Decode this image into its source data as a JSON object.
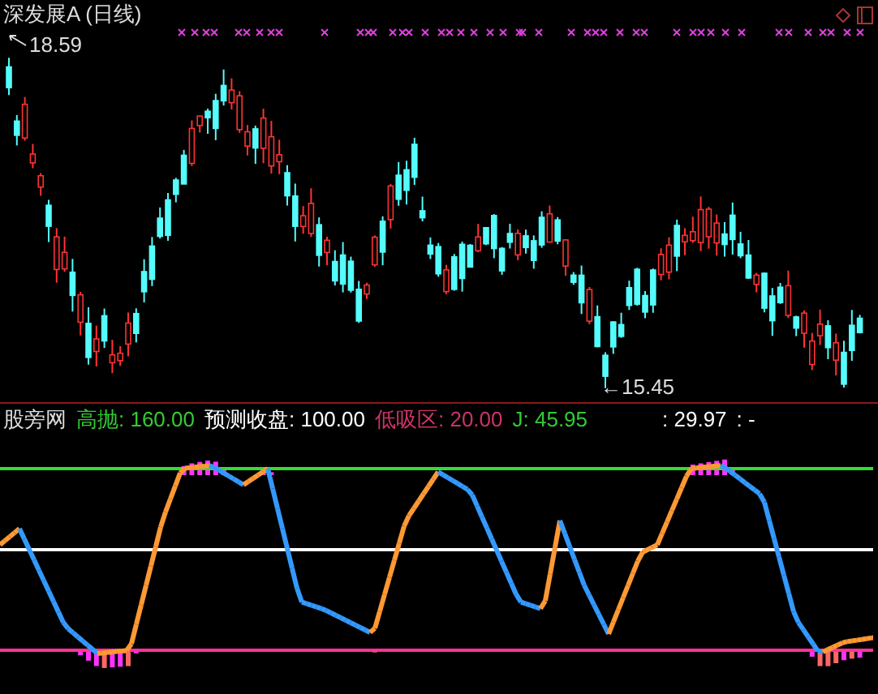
{
  "main_pane": {
    "title": "深发展A (日线)",
    "high_label": "18.59",
    "low_label": "←15.45"
  },
  "indicator": {
    "name": "股旁网",
    "values": [
      {
        "text": "高抛: 160.00",
        "color": "#33cc33"
      },
      {
        "text": "预测收盘: 100.00",
        "color": "#ffffff"
      },
      {
        "text": "低吸区: 20.00",
        "color": "#cc3366"
      },
      {
        "text": "J: 45.95",
        "color": "#33cc33"
      },
      {
        "text": ": 29.97",
        "color": "#ffffff"
      },
      {
        "text": ": -",
        "color": "#ffffff"
      }
    ]
  }
}
